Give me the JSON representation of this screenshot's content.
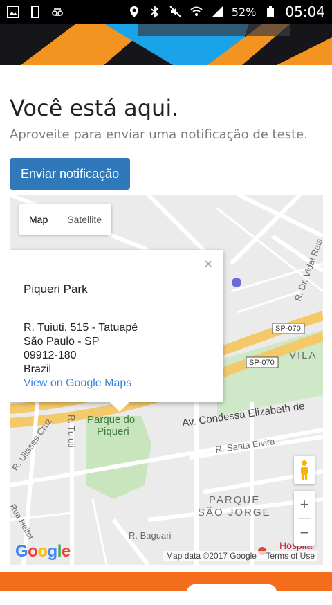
{
  "status_bar": {
    "battery_percent": "52%",
    "time": "05:04",
    "left_icons": [
      "image-icon",
      "sim-icon",
      "voicemail-icon"
    ],
    "right_icons": [
      "location-icon",
      "bluetooth-icon",
      "mute-icon",
      "wifi-icon",
      "signal-icon",
      "battery-icon"
    ]
  },
  "page": {
    "title": "Você está aqui.",
    "subtitle": "Aproveite para enviar uma notificação de teste.",
    "button_label": "Enviar notificação"
  },
  "colors": {
    "primary_button": "#2f79bb",
    "footer": "#f46d1b",
    "link": "#3a84df",
    "banner_orange": "#f39320",
    "banner_blue": "#1aa3e8"
  },
  "map": {
    "type_options": [
      "Map",
      "Satellite"
    ],
    "active_type": "Map",
    "infowindow": {
      "name": "Piqueri Park",
      "address_lines": [
        "R. Tuiuti, 515 - Tatuapé",
        "São Paulo - SP",
        "09912-180",
        "Brazil"
      ],
      "link": "View on Google Maps",
      "close": "×"
    },
    "labels": {
      "park": "Parque do",
      "park2": "Piqueri",
      "avenue": "Av. Condessa Elizabeth de",
      "santa_elvira": "R. Santa Elvira",
      "parque": "PARQUE",
      "sao_jorge": "SÃO JORGE",
      "baguari": "R. Baguari",
      "vila": "VILA",
      "sp070a": "SP-070",
      "sp070b": "SP-070",
      "vidal": "R. Dr. Vidal Reis",
      "tuiuti": "R. Tuiuti",
      "ulisses": "R. Ulisses Cruz",
      "hospital": "Hospita",
      "heitor": "Rua Heitor"
    },
    "zoom_in": "+",
    "zoom_out": "−",
    "google": "Google",
    "attribution": [
      "Map data ©2017 Google",
      "Terms of Use"
    ]
  }
}
